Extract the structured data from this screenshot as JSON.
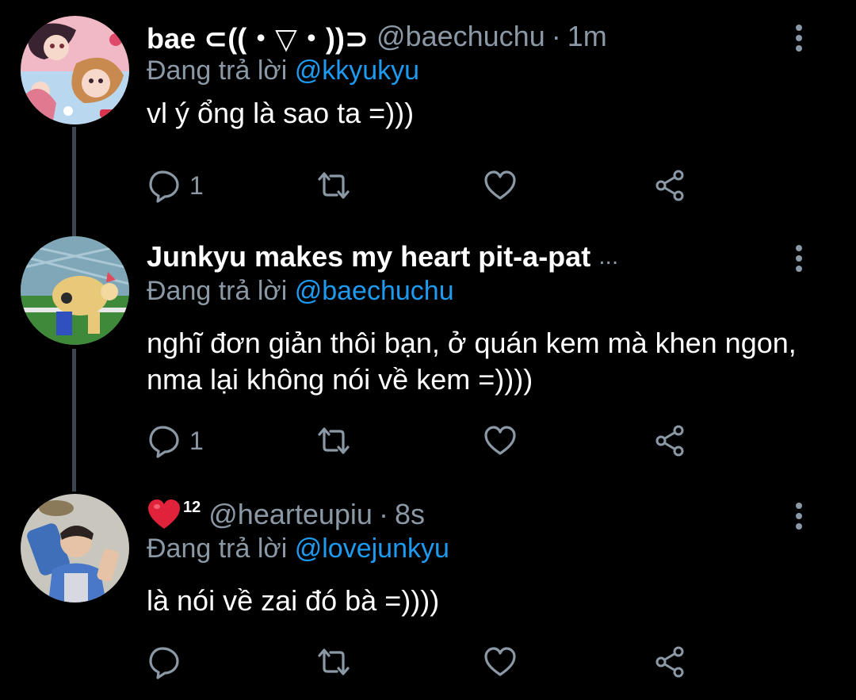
{
  "colors": {
    "background": "#000000",
    "primary_text": "#ffffff",
    "secondary_text": "#8b98a5",
    "mention": "#1d9bf0",
    "thread_line": "#3b4650",
    "heart_emoji": "#e0223a"
  },
  "replying_prefix": "Đang trả lời",
  "tweets": [
    {
      "display_name": "bae ⊂((・▽・))⊃",
      "handle": "@baechuchu",
      "separator": "·",
      "time": "1m",
      "reply_to": "@kkyukyu",
      "text": "vl ý ổng là sao ta =)))",
      "reply_count": "1",
      "avatar_icon": "anime-girls-avatar"
    },
    {
      "display_name": "Junkyu makes my heart pit-a-pat",
      "truncation": "...",
      "reply_to": "@baechuchu",
      "text": "nghĩ đơn giản thôi bạn, ở quán kem mà khen ngon, nma lại không nói về kem =))))",
      "reply_count": "1",
      "avatar_icon": "cartoon-meme-avatar"
    },
    {
      "name_emoji": "red-heart-icon",
      "name_suffix": "12",
      "handle": "@hearteupiu",
      "separator": "·",
      "time": "8s",
      "reply_to": "@lovejunkyu",
      "text": "là nói về zai đó bà =))))",
      "reply_count": "",
      "avatar_icon": "boy-photo-avatar"
    }
  ],
  "action_icons": [
    "reply-icon",
    "retweet-icon",
    "like-icon",
    "share-icon"
  ],
  "more_icon": "more-vertical-icon"
}
